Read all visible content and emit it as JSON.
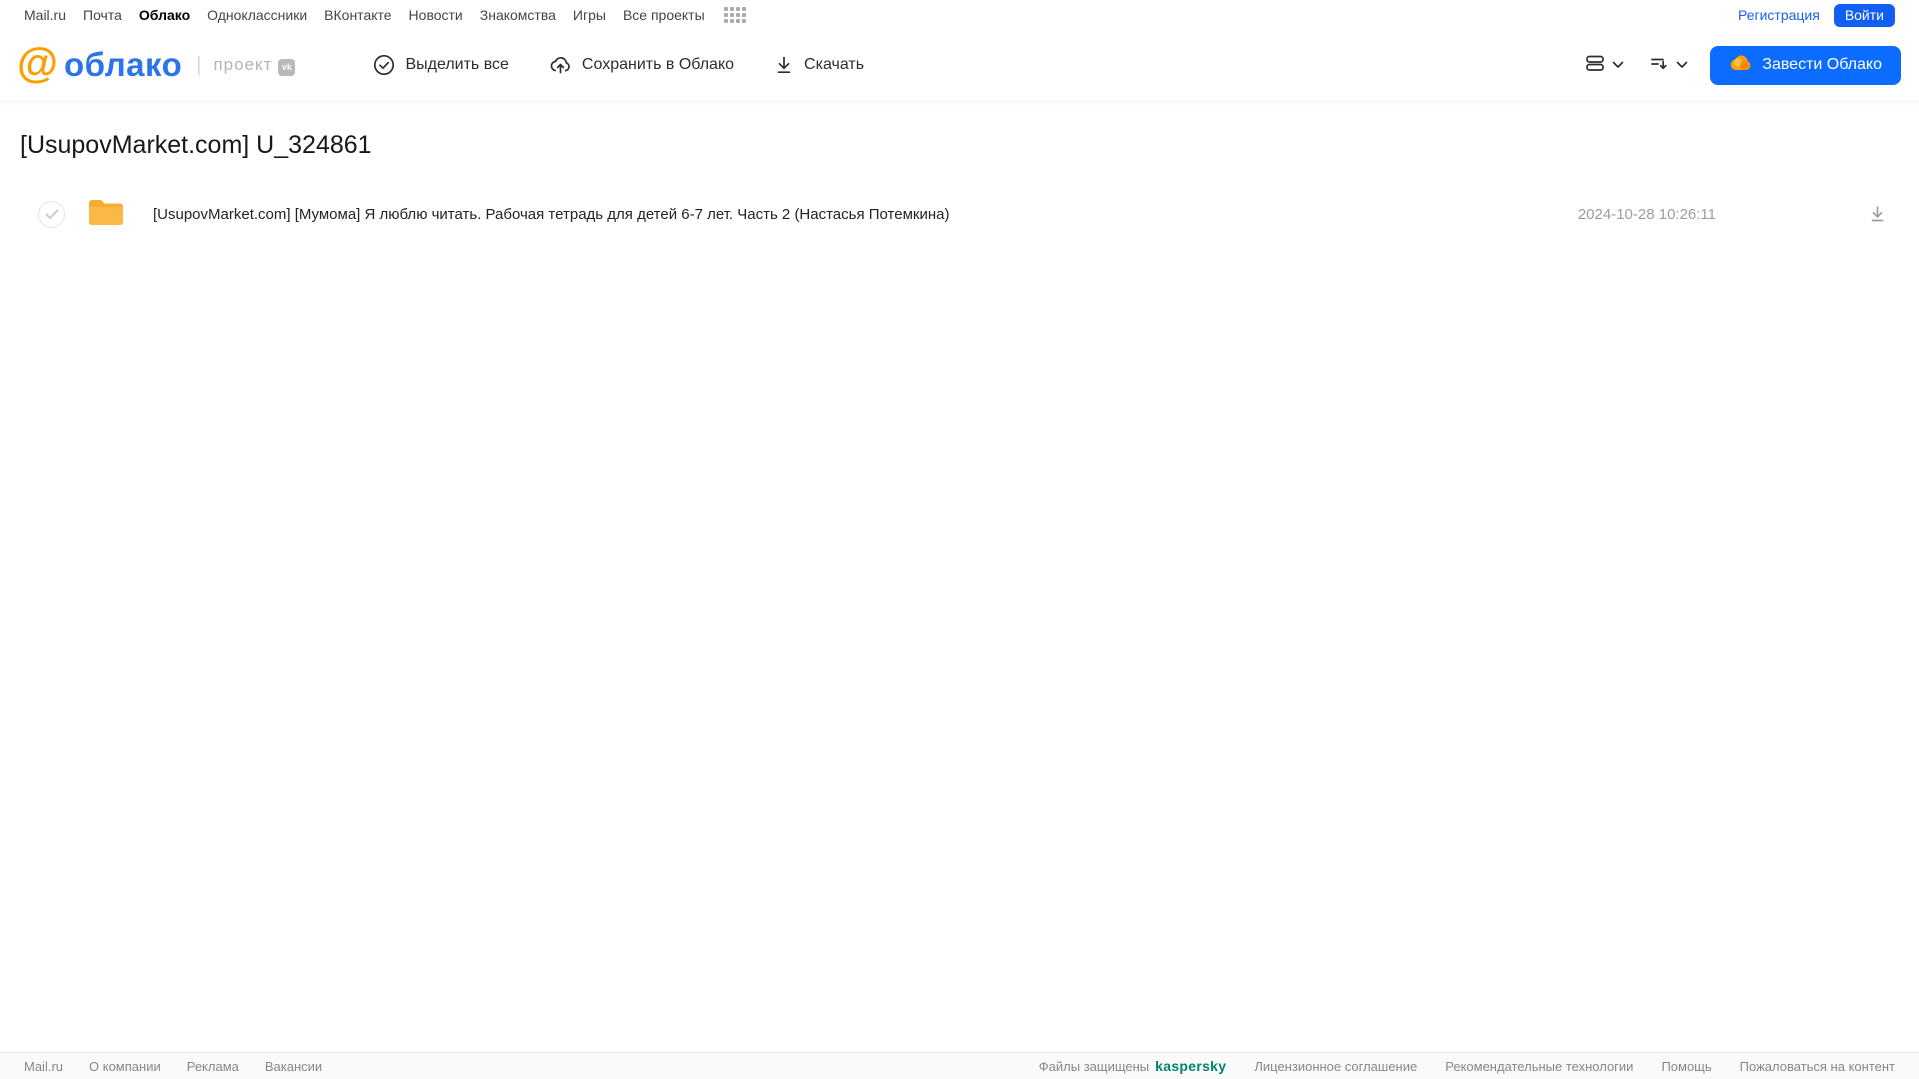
{
  "portal_nav": {
    "links": [
      "Mail.ru",
      "Почта",
      "Облако",
      "Одноклассники",
      "ВКонтакте",
      "Новости",
      "Знакомства",
      "Игры",
      "Все проекты"
    ],
    "registration": "Регистрация",
    "login": "Войти"
  },
  "header": {
    "logo_text": "облако",
    "logo_divider": "|",
    "project_label": "проект",
    "vk_badge": "vk",
    "toolbar": {
      "select_all": "Выделить все",
      "save_to_cloud": "Сохранить в Облако",
      "download": "Скачать"
    },
    "get_cloud_button": "Завести Облако"
  },
  "main": {
    "title": "[UsupovMarket.com] U_324861",
    "file": {
      "name": "[UsupovMarket.com] [Мумома] Я люблю читать. Рабочая тетрадь для детей 6-7 лет. Часть 2 (Настасья Потемкина)",
      "date": "2024-10-28 10:26:11"
    }
  },
  "footer": {
    "left_links": [
      "Mail.ru",
      "О компании",
      "Реклама",
      "Вакансии"
    ],
    "protected_label": "Файлы защищены",
    "kaspersky": "kaspersky",
    "right_links": [
      "Лицензионное соглашение",
      "Рекомендательные технологии",
      "Помощь",
      "Пожаловаться на контент"
    ]
  },
  "colors": {
    "brand_blue": "#0b6cff",
    "logo_blue": "#2b74ea",
    "logo_orange": "#ff9e00",
    "folder_orange": "#fbb844",
    "kaspersky_green": "#00846e"
  }
}
